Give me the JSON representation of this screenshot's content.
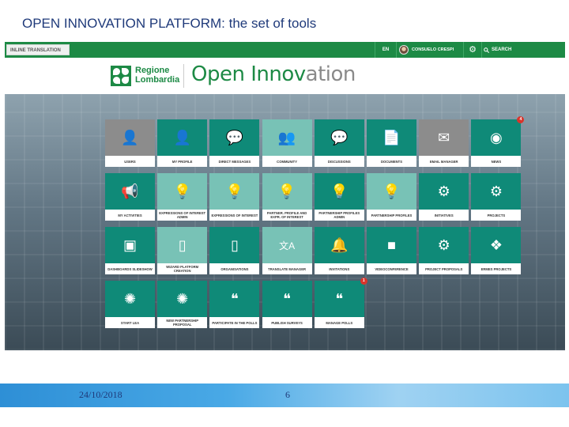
{
  "slide": {
    "title": "OPEN INNOVATION PLATFORM: the set of tools"
  },
  "topbar": {
    "inline_translation": "INLINE TRANSLATION",
    "language": "EN",
    "user_name": "CONSUELO CRESPI",
    "search_label": "SEARCH",
    "settings_icon": "gear-icon",
    "search_icon": "magnifier-icon"
  },
  "header": {
    "logo_line1": "Regione",
    "logo_line2": "Lombardia",
    "brand_part1": "Open Innov",
    "brand_part2": "ation"
  },
  "colors": {
    "brand_green": "#1d8a45",
    "tile_dark": "#0f8a78",
    "tile_light": "#78c2b6",
    "tile_gray": "#8c8c8c",
    "badge_red": "#d9342b"
  },
  "tiles": [
    {
      "label": "USERS",
      "icon": "users-icon",
      "color": "gray"
    },
    {
      "label": "MY PROFILE",
      "icon": "person-icon",
      "color": "dark"
    },
    {
      "label": "DIRECT MESSAGES",
      "icon": "chat-bubbles-icon",
      "color": "dark"
    },
    {
      "label": "COMMUNITY",
      "icon": "group-icon",
      "color": "light"
    },
    {
      "label": "DISCUSSIONS",
      "icon": "speech-bubble-icon",
      "color": "dark"
    },
    {
      "label": "DOCUMENTS",
      "icon": "document-icon",
      "color": "dark"
    },
    {
      "label": "EMAIL MANAGER",
      "icon": "envelope-icon",
      "color": "gray"
    },
    {
      "label": "NEWS",
      "icon": "rss-icon",
      "color": "dark",
      "badge": "4"
    },
    {
      "label": "MY ACTIVITIES",
      "icon": "megaphone-icon",
      "color": "dark"
    },
    {
      "label": "EXPRESSIONS OF INTEREST ADMIN",
      "icon": "lightbulb-icon",
      "color": "light"
    },
    {
      "label": "EXPRESSIONS OF INTEREST",
      "icon": "lightbulb-icon",
      "color": "light"
    },
    {
      "label": "PARTNER. PROFILE AND EXPR. OF INTEREST",
      "icon": "lightbulb-icon",
      "color": "light"
    },
    {
      "label": "PARTNERSHIP PROFILES ADMIN",
      "icon": "lightbulb-icon",
      "color": "dark"
    },
    {
      "label": "PARTNERSHIP PROFILES",
      "icon": "lightbulb-icon",
      "color": "light"
    },
    {
      "label": "INITIATIVES",
      "icon": "gears-icon",
      "color": "dark"
    },
    {
      "label": "PROJECTS",
      "icon": "gears-icon",
      "color": "dark"
    },
    {
      "label": "DASHBOARDS SLIDESHOW",
      "icon": "image-icon",
      "color": "dark"
    },
    {
      "label": "WIZARD PLATFORM CREATION",
      "icon": "tablet-icon",
      "color": "light"
    },
    {
      "label": "ORGANISATIONS",
      "icon": "phone-icon",
      "color": "dark"
    },
    {
      "label": "TRANSLATE MANAGER",
      "icon": "translate-icon",
      "color": "light"
    },
    {
      "label": "INVITATIONS",
      "icon": "bell-icon",
      "color": "dark"
    },
    {
      "label": "VIDEOCONFERENCE",
      "icon": "video-camera-icon",
      "color": "dark"
    },
    {
      "label": "PROJECT PROPOSALS",
      "icon": "gears-icon",
      "color": "dark"
    },
    {
      "label": "ERMES PROJECTS",
      "icon": "cubes-icon",
      "color": "dark"
    },
    {
      "label": "START LEA",
      "icon": "bulb-rays-icon",
      "color": "dark"
    },
    {
      "label": "NEW PARTNERSHIP PROPOSAL",
      "icon": "bulb-rays-icon",
      "color": "dark"
    },
    {
      "label": "PARTICIPATE IN THE POLLS",
      "icon": "quote-icon",
      "color": "dark"
    },
    {
      "label": "PUBLISH SURVEYS",
      "icon": "quote-icon",
      "color": "dark"
    },
    {
      "label": "MANAGE POLLS",
      "icon": "quote-icon",
      "color": "dark",
      "badge": "1"
    }
  ],
  "footer": {
    "date": "24/10/2018",
    "page_number": "6"
  }
}
